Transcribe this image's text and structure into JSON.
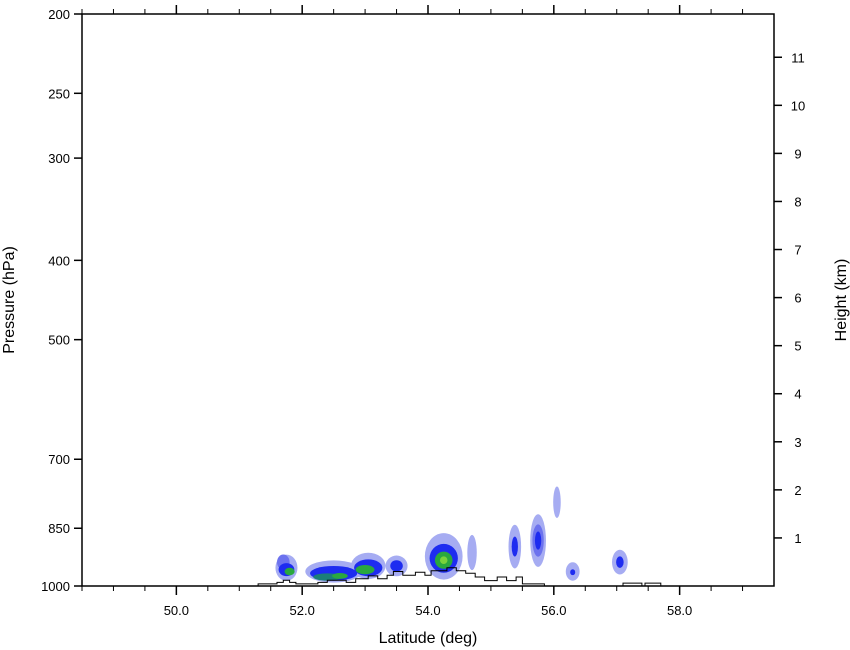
{
  "chart_data": {
    "type": "heatmap",
    "title": "",
    "xlabel": "Latitude (deg)",
    "ylabel": "Pressure (hPa)",
    "y2label": "Height (km)",
    "xlim": [
      48.5,
      59.5
    ],
    "ylim": [
      1000,
      200
    ],
    "y_scale": "log",
    "y2lim": [
      0,
      11.9
    ],
    "grid": false,
    "legend": "none",
    "x_ticks": [
      50.0,
      52.0,
      54.0,
      56.0,
      58.0
    ],
    "x_tick_labels": [
      "50.0",
      "52.0",
      "54.0",
      "56.0",
      "58.0"
    ],
    "x_minor_ticks": [
      48.5,
      49.0,
      49.5,
      50.5,
      51.0,
      51.5,
      52.5,
      53.0,
      53.5,
      54.5,
      55.0,
      55.5,
      56.5,
      57.0,
      57.5,
      58.5,
      59.0
    ],
    "y_ticks": [
      1000,
      850,
      700,
      500,
      400,
      300,
      250,
      200
    ],
    "y_tick_labels": [
      "1000",
      "850",
      "700",
      "500",
      "400",
      "300",
      "250",
      "200"
    ],
    "y2_ticks": [
      1,
      2,
      3,
      4,
      5,
      6,
      7,
      8,
      9,
      10,
      11
    ],
    "y2_tick_labels": [
      "1",
      "2",
      "3",
      "4",
      "5",
      "6",
      "7",
      "8",
      "9",
      "10",
      "11"
    ],
    "colors": {
      "level1": "#a6acf2",
      "level2": "#6c72ee",
      "level3": "#1e2cf0",
      "level4": "#1b7f77",
      "level5": "#2aa83e",
      "level6": "#7ad23a",
      "terrain": "#000000"
    },
    "contour_cells": [
      {
        "lat": 51.75,
        "p": 950,
        "w": 0.35,
        "h": 70,
        "level": 1
      },
      {
        "lat": 51.7,
        "p": 935,
        "w": 0.2,
        "h": 40,
        "level": 2
      },
      {
        "lat": 51.75,
        "p": 955,
        "w": 0.25,
        "h": 35,
        "level": 3
      },
      {
        "lat": 51.8,
        "p": 960,
        "w": 0.16,
        "h": 20,
        "level": 5
      },
      {
        "lat": 52.5,
        "p": 960,
        "w": 0.9,
        "h": 60,
        "level": 1
      },
      {
        "lat": 52.5,
        "p": 965,
        "w": 0.75,
        "h": 40,
        "level": 3
      },
      {
        "lat": 52.4,
        "p": 975,
        "w": 0.45,
        "h": 20,
        "level": 4
      },
      {
        "lat": 52.6,
        "p": 972,
        "w": 0.25,
        "h": 16,
        "level": 5
      },
      {
        "lat": 53.05,
        "p": 945,
        "w": 0.55,
        "h": 70,
        "level": 1
      },
      {
        "lat": 53.05,
        "p": 950,
        "w": 0.45,
        "h": 45,
        "level": 3
      },
      {
        "lat": 53.0,
        "p": 955,
        "w": 0.3,
        "h": 25,
        "level": 5
      },
      {
        "lat": 53.5,
        "p": 945,
        "w": 0.35,
        "h": 55,
        "level": 1
      },
      {
        "lat": 53.5,
        "p": 945,
        "w": 0.2,
        "h": 30,
        "level": 3
      },
      {
        "lat": 54.25,
        "p": 920,
        "w": 0.6,
        "h": 120,
        "level": 1
      },
      {
        "lat": 54.25,
        "p": 925,
        "w": 0.45,
        "h": 75,
        "level": 3
      },
      {
        "lat": 54.25,
        "p": 930,
        "w": 0.28,
        "h": 45,
        "level": 5
      },
      {
        "lat": 54.25,
        "p": 930,
        "w": 0.12,
        "h": 20,
        "level": 6
      },
      {
        "lat": 54.7,
        "p": 910,
        "w": 0.15,
        "h": 90,
        "level": 1
      },
      {
        "lat": 55.38,
        "p": 895,
        "w": 0.2,
        "h": 110,
        "level": 1
      },
      {
        "lat": 55.38,
        "p": 895,
        "w": 0.1,
        "h": 50,
        "level": 3
      },
      {
        "lat": 55.75,
        "p": 880,
        "w": 0.25,
        "h": 130,
        "level": 1
      },
      {
        "lat": 55.75,
        "p": 880,
        "w": 0.18,
        "h": 80,
        "level": 2
      },
      {
        "lat": 55.75,
        "p": 880,
        "w": 0.1,
        "h": 45,
        "level": 3
      },
      {
        "lat": 56.05,
        "p": 790,
        "w": 0.12,
        "h": 70,
        "level": 1
      },
      {
        "lat": 56.3,
        "p": 960,
        "w": 0.22,
        "h": 50,
        "level": 1
      },
      {
        "lat": 56.3,
        "p": 962,
        "w": 0.08,
        "h": 16,
        "level": 3
      },
      {
        "lat": 57.05,
        "p": 935,
        "w": 0.25,
        "h": 65,
        "level": 1
      },
      {
        "lat": 57.05,
        "p": 935,
        "w": 0.12,
        "h": 30,
        "level": 3
      }
    ],
    "terrain_outline": [
      [
        51.3,
        1000
      ],
      [
        51.3,
        994
      ],
      [
        51.6,
        994
      ],
      [
        51.6,
        990
      ],
      [
        51.7,
        990
      ],
      [
        51.7,
        984
      ],
      [
        51.8,
        984
      ],
      [
        51.8,
        990
      ],
      [
        51.9,
        990
      ],
      [
        51.9,
        994
      ],
      [
        52.25,
        994
      ],
      [
        52.25,
        990
      ],
      [
        52.4,
        990
      ],
      [
        52.4,
        984
      ],
      [
        52.7,
        984
      ],
      [
        52.7,
        990
      ],
      [
        52.85,
        990
      ],
      [
        52.85,
        980
      ],
      [
        53.05,
        980
      ],
      [
        53.05,
        972
      ],
      [
        53.2,
        972
      ],
      [
        53.2,
        980
      ],
      [
        53.35,
        980
      ],
      [
        53.35,
        970
      ],
      [
        53.45,
        970
      ],
      [
        53.45,
        960
      ],
      [
        53.6,
        960
      ],
      [
        53.6,
        970
      ],
      [
        53.8,
        970
      ],
      [
        53.8,
        962
      ],
      [
        53.95,
        962
      ],
      [
        53.95,
        970
      ],
      [
        54.05,
        970
      ],
      [
        54.05,
        958
      ],
      [
        54.3,
        958
      ],
      [
        54.3,
        950
      ],
      [
        54.45,
        950
      ],
      [
        54.45,
        958
      ],
      [
        54.6,
        958
      ],
      [
        54.6,
        965
      ],
      [
        54.75,
        965
      ],
      [
        54.75,
        975
      ],
      [
        54.9,
        975
      ],
      [
        54.9,
        985
      ],
      [
        55.1,
        985
      ],
      [
        55.1,
        975
      ],
      [
        55.25,
        975
      ],
      [
        55.25,
        985
      ],
      [
        55.4,
        985
      ],
      [
        55.4,
        975
      ],
      [
        55.5,
        975
      ],
      [
        55.5,
        994
      ],
      [
        55.85,
        994
      ],
      [
        55.85,
        1000
      ]
    ],
    "terrain_outline2": [
      [
        57.1,
        1000
      ],
      [
        57.1,
        992
      ],
      [
        57.4,
        992
      ],
      [
        57.4,
        1000
      ],
      [
        57.45,
        1000
      ],
      [
        57.45,
        992
      ],
      [
        57.7,
        992
      ],
      [
        57.7,
        1000
      ]
    ]
  }
}
